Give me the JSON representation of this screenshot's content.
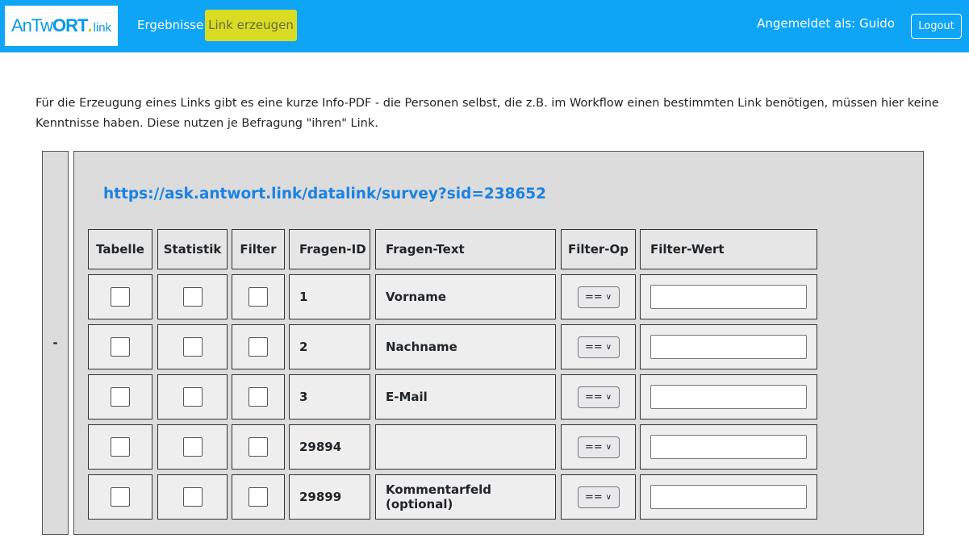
{
  "navbar": {
    "brand": {
      "part1": "AnTw",
      "part2": "ORT",
      "part3": ".",
      "part4": "link"
    },
    "ergebnisse": "Ergebnisse",
    "link_erzeugen": "Link erzeugen",
    "user": "Angemeldet als: Guido",
    "logout": "Logout"
  },
  "intro": "Für die Erzeugung eines Links gibt es eine kurze Info-PDF - die Personen selbst, die z.B. im Workflow einen bestimmten Link benötigen, müssen hier keine Kenntnisse haben. Diese nutzen je Befragung \"ihren\" Link.",
  "collapse_toggle": "-",
  "panel": {
    "link": "https://ask.antwort.link/datalink/survey?sid=238652",
    "headers": [
      "Tabelle",
      "Statistik",
      "Filter",
      "Fragen-ID",
      "Fragen-Text",
      "Filter-Op",
      "Filter-Wert"
    ],
    "rows": [
      {
        "id": "1",
        "text": "Vorname",
        "op": "==",
        "value": ""
      },
      {
        "id": "2",
        "text": "Nachname",
        "op": "==",
        "value": ""
      },
      {
        "id": "3",
        "text": "E-Mail",
        "op": "==",
        "value": ""
      },
      {
        "id": "29894",
        "text": "",
        "op": "==",
        "value": ""
      },
      {
        "id": "29899",
        "text": "Kommentarfeld (optional)",
        "op": "==",
        "value": ""
      }
    ]
  }
}
